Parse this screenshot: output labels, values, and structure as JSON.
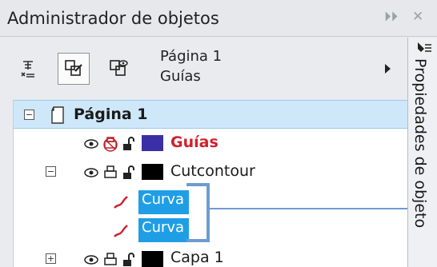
{
  "window": {
    "title": "Administrador de objetos",
    "controls": [
      "⏵⏵",
      "✕"
    ]
  },
  "toolbar": {
    "buttons": [
      {
        "icon": "layer-options-icon"
      },
      {
        "icon": "edit-across-layers-icon"
      },
      {
        "icon": "layer-manager-view-icon"
      }
    ],
    "page_label": "Página 1",
    "layer_label": "Guías"
  },
  "tree": {
    "page": {
      "label": "Página 1",
      "expander": "−"
    },
    "layers": [
      {
        "label": "Guías",
        "color": "#3b2fa6",
        "style": "master"
      },
      {
        "label": "Cutcontour",
        "color": "#000000",
        "expander": "−",
        "children": [
          {
            "label": "Curva",
            "selected": true
          },
          {
            "label": "Curva",
            "selected": true
          }
        ]
      },
      {
        "label": "Capa 1",
        "color": "#000000",
        "expander": "+"
      }
    ]
  },
  "sidetab": {
    "label": "Propiedades de objeto"
  },
  "colors": {
    "selection": "#1f9ee6",
    "page_row": "#cfe8f9",
    "callout": "#6f9bd1",
    "guides_red": "#d0202c"
  }
}
